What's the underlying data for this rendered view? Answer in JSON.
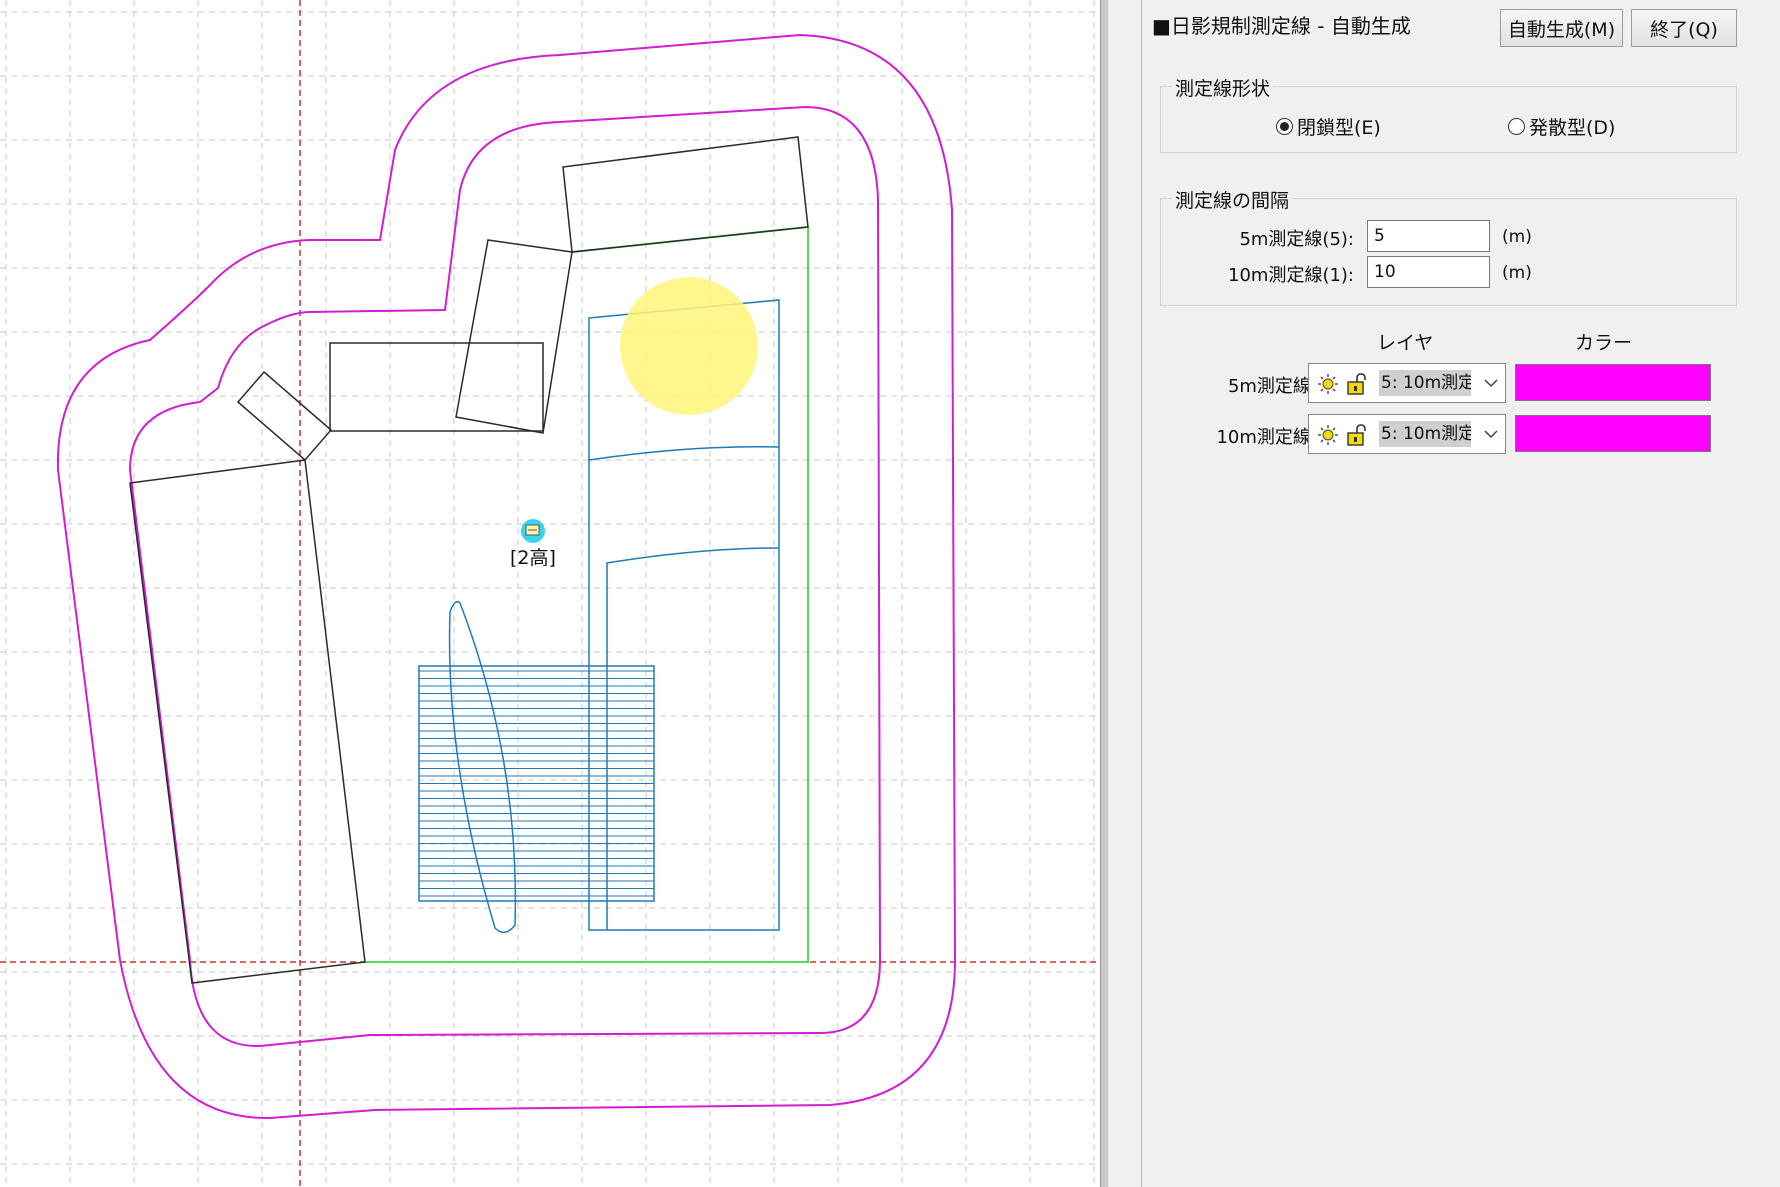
{
  "canvas": {
    "point_marker_label": "[2高]",
    "colors": {
      "grid": "#c9c9c9",
      "axis": "#c0392b",
      "measure_line": "#d21ed2",
      "site_outline": "#55dd55",
      "building": "#2a2a2a",
      "structure": "#1f7ab8",
      "highlight": "#fff47a"
    }
  },
  "panel": {
    "title": "■日影規制測定線 - 自動生成",
    "auto_generate_button": "自動生成(M)",
    "exit_button": "終了(Q)",
    "shape_group": {
      "label": "測定線形状",
      "options": [
        {
          "label": "閉鎖型(E)",
          "selected": true
        },
        {
          "label": "発散型(D)",
          "selected": false
        }
      ]
    },
    "interval_group": {
      "label": "測定線の間隔",
      "rows": [
        {
          "label": "5m測定線(5):",
          "value": "5",
          "unit": "(m)"
        },
        {
          "label": "10m測定線(1):",
          "value": "10",
          "unit": "(m)"
        }
      ]
    },
    "layer_header": "レイヤ",
    "color_header": "カラー",
    "line_rows": [
      {
        "label": "5m測定線:",
        "layer": "5: 10m測定",
        "color": "#ff00ff",
        "layer_icon": "sun-icon",
        "lock_icon": "unlock-icon"
      },
      {
        "label": "10m測定線:",
        "layer": "5: 10m測定",
        "color": "#ff00ff",
        "layer_icon": "sun-icon",
        "lock_icon": "unlock-icon"
      }
    ]
  }
}
